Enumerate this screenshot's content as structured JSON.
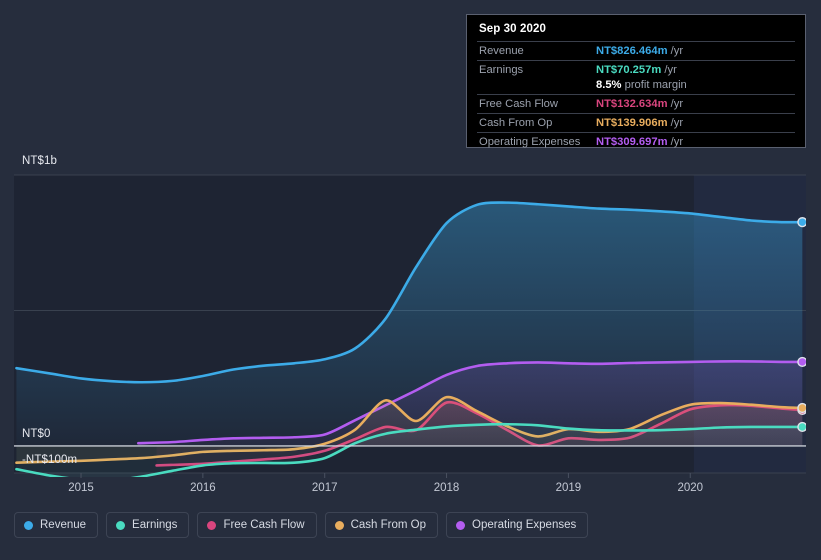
{
  "chart_data": {
    "type": "line",
    "title": "",
    "xlabel": "",
    "ylabel": "",
    "currency": "NT$",
    "grid": true,
    "legend_position": "bottom",
    "xlim": [
      2014.45,
      2020.95
    ],
    "ylim": [
      -150,
      1000
    ],
    "y_ticks": [
      {
        "value": 1000,
        "label": "NT$1b"
      },
      {
        "value": 500,
        "label": ""
      },
      {
        "value": 0,
        "label": "NT$0"
      },
      {
        "value": -100,
        "label": "-NT$100m"
      }
    ],
    "x_ticks": [
      {
        "value": 2015,
        "label": "2015"
      },
      {
        "value": 2016,
        "label": "2016"
      },
      {
        "value": 2017,
        "label": "2017"
      },
      {
        "value": 2018,
        "label": "2018"
      },
      {
        "value": 2019,
        "label": "2019"
      },
      {
        "value": 2020,
        "label": "2020"
      }
    ],
    "forecast_start": 2020.03,
    "series": [
      {
        "name": "Revenue",
        "color": "#3cabe8",
        "x": [
          2014.47,
          2014.75,
          2015.0,
          2015.25,
          2015.5,
          2015.75,
          2016.0,
          2016.25,
          2016.5,
          2016.75,
          2017.0,
          2017.25,
          2017.5,
          2017.75,
          2018.0,
          2018.25,
          2018.5,
          2018.75,
          2019.0,
          2019.25,
          2019.5,
          2019.75,
          2020.0,
          2020.25,
          2020.5,
          2020.75,
          2020.92
        ],
        "values": [
          287,
          267,
          249,
          239,
          235,
          240,
          258,
          282,
          296,
          305,
          320,
          360,
          470,
          660,
          822,
          890,
          898,
          892,
          884,
          876,
          872,
          866,
          858,
          845,
          832,
          826,
          826
        ]
      },
      {
        "name": "Earnings",
        "color": "#4adbc0",
        "x": [
          2014.47,
          2014.75,
          2015.0,
          2015.25,
          2015.5,
          2015.75,
          2016.0,
          2016.25,
          2016.5,
          2016.75,
          2017.0,
          2017.25,
          2017.5,
          2017.75,
          2018.0,
          2018.25,
          2018.5,
          2018.75,
          2019.0,
          2019.25,
          2019.5,
          2019.75,
          2020.0,
          2020.25,
          2020.5,
          2020.75,
          2020.92
        ],
        "values": [
          -86,
          -110,
          -124,
          -128,
          -113,
          -92,
          -72,
          -64,
          -63,
          -62,
          -45,
          10,
          45,
          60,
          72,
          78,
          80,
          76,
          64,
          58,
          57,
          58,
          62,
          68,
          70,
          70,
          70
        ]
      },
      {
        "name": "Free Cash Flow",
        "color": "#d9457e",
        "x": [
          2015.62,
          2015.75,
          2016.0,
          2016.25,
          2016.5,
          2016.75,
          2017.0,
          2017.25,
          2017.5,
          2017.75,
          2018.0,
          2018.25,
          2018.5,
          2018.75,
          2019.0,
          2019.25,
          2019.5,
          2019.75,
          2020.0,
          2020.25,
          2020.5,
          2020.75,
          2020.92
        ],
        "values": [
          -72,
          -70,
          -66,
          -58,
          -50,
          -40,
          -18,
          25,
          70,
          58,
          160,
          120,
          58,
          2,
          28,
          22,
          30,
          80,
          135,
          150,
          148,
          138,
          133
        ]
      },
      {
        "name": "Cash From Op",
        "color": "#e8a košice",
        "values_note": "see cash_from_op"
      }
    ],
    "cash_from_op": {
      "name": "Cash From Op",
      "color": "#e8ad5e",
      "x": [
        2014.47,
        2014.75,
        2015.0,
        2015.25,
        2015.5,
        2015.75,
        2016.0,
        2016.25,
        2016.5,
        2016.75,
        2017.0,
        2017.25,
        2017.5,
        2017.75,
        2018.0,
        2018.25,
        2018.5,
        2018.75,
        2019.0,
        2019.25,
        2019.5,
        2019.75,
        2020.0,
        2020.25,
        2020.5,
        2020.75,
        2020.92
      ],
      "values": [
        -62,
        -58,
        -55,
        -50,
        -45,
        -35,
        -22,
        -18,
        -16,
        -12,
        8,
        60,
        168,
        92,
        180,
        128,
        72,
        35,
        62,
        52,
        62,
        112,
        152,
        158,
        152,
        143,
        140
      ]
    },
    "operating_expenses": {
      "name": "Operating Expenses",
      "color": "#b35df0",
      "x": [
        2015.47,
        2015.75,
        2016.0,
        2016.25,
        2016.5,
        2016.75,
        2017.0,
        2017.25,
        2017.5,
        2017.75,
        2018.0,
        2018.25,
        2018.5,
        2018.75,
        2019.0,
        2019.25,
        2019.5,
        2019.75,
        2020.0,
        2020.25,
        2020.5,
        2020.75,
        2020.92
      ],
      "values": [
        10,
        14,
        22,
        28,
        30,
        32,
        42,
        95,
        150,
        205,
        262,
        295,
        305,
        308,
        305,
        303,
        306,
        308,
        310,
        312,
        312,
        310,
        310
      ]
    }
  },
  "tooltip": {
    "date": "Sep 30 2020",
    "rows": [
      {
        "key": "Revenue",
        "value": "NT$826.464m",
        "unit": " /yr",
        "color": "#3cabe8",
        "sub": null
      },
      {
        "key": "Earnings",
        "value": "NT$70.257m",
        "unit": " /yr",
        "color": "#4adbc0",
        "sub": {
          "num": "8.5%",
          "text": " profit margin"
        }
      },
      {
        "key": "Free Cash Flow",
        "value": "NT$132.634m",
        "unit": " /yr",
        "color": "#d9457e",
        "sub": null
      },
      {
        "key": "Cash From Op",
        "value": "NT$139.906m",
        "unit": " /yr",
        "color": "#e8ad5e",
        "sub": null
      },
      {
        "key": "Operating Expenses",
        "value": "NT$309.697m",
        "unit": " /yr",
        "color": "#b35df0",
        "sub": null
      }
    ]
  },
  "legend": {
    "items": [
      {
        "label": "Revenue",
        "color": "#3cabe8"
      },
      {
        "label": "Earnings",
        "color": "#4adbc0"
      },
      {
        "label": "Free Cash Flow",
        "color": "#d9457e"
      },
      {
        "label": "Cash From Op",
        "color": "#e8ad5e"
      },
      {
        "label": "Operating Expenses",
        "color": "#b35df0"
      }
    ]
  },
  "axis": {
    "y_top_label": "NT$1b",
    "y_zero_label": "NT$0",
    "y_bottom_label": "-NT$100m",
    "x_labels": [
      "2015",
      "2016",
      "2017",
      "2018",
      "2019",
      "2020"
    ]
  },
  "colors": {
    "background": "#262d3d",
    "plot_background": "#1e2433",
    "forecast_background": "#222a3c",
    "gridline": "#39414f",
    "zeroline": "#d6dae2",
    "tooltip_background": "#000000",
    "tooltip_border": "#5a6070"
  }
}
